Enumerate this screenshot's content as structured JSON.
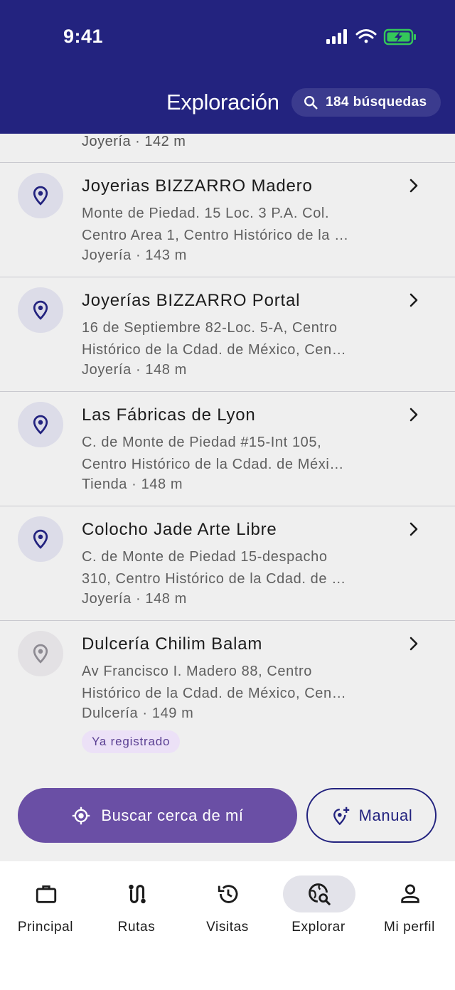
{
  "status_bar": {
    "time": "9:41"
  },
  "header": {
    "title": "Exploración",
    "search_chip_label": "184 búsquedas"
  },
  "partial_item": {
    "meta": "Joyería · 142 m"
  },
  "places": [
    {
      "name": "Joyerias BIZZARRO Madero",
      "address_line1": "Monte de Piedad. 15 Loc. 3 P.A. Col.",
      "address_line2": "Centro Area 1, Centro Histórico de la …",
      "meta": "Joyería · 143 m"
    },
    {
      "name": "Joyerías BIZZARRO Portal",
      "address_line1": "16 de Septiembre 82-Loc. 5-A, Centro",
      "address_line2": "Histórico de la Cdad. de México, Cen…",
      "meta": "Joyería · 148 m"
    },
    {
      "name": "Las Fábricas de Lyon",
      "address_line1": "C. de Monte de Piedad #15-Int 105,",
      "address_line2": "Centro Histórico de la Cdad. de Méxi…",
      "meta": "Tienda · 148 m"
    },
    {
      "name": "Colocho Jade Arte Libre",
      "address_line1": "C. de Monte de Piedad 15-despacho",
      "address_line2": "310, Centro Histórico de la Cdad. de …",
      "meta": "Joyería · 148 m"
    },
    {
      "name": "Dulcería Chilim Balam",
      "address_line1": "Av Francisco I. Madero 88, Centro",
      "address_line2": "Histórico de la Cdad. de México, Cen…",
      "meta": "Dulcería · 149 m",
      "badge": "Ya registrado"
    }
  ],
  "actions": {
    "nearby_label": "Buscar cerca de mí",
    "manual_label": "Manual"
  },
  "nav": [
    {
      "label": "Principal",
      "icon": "briefcase-icon"
    },
    {
      "label": "Rutas",
      "icon": "route-icon"
    },
    {
      "label": "Visitas",
      "icon": "history-icon"
    },
    {
      "label": "Explorar",
      "icon": "travel-explore-icon",
      "active": true
    },
    {
      "label": "Mi perfil",
      "icon": "person-icon"
    }
  ],
  "colors": {
    "header_bg": "#23237f",
    "primary_button": "#6a4fa5",
    "list_bg": "#efefef",
    "badge_bg": "#ece1f7",
    "battery": "#34c759"
  }
}
